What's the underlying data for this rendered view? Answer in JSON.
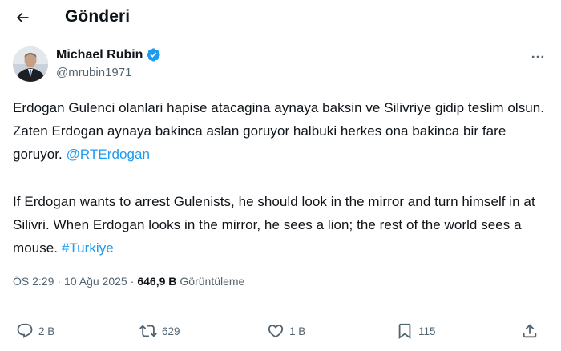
{
  "header": {
    "title": "Gönderi"
  },
  "author": {
    "name": "Michael Rubin",
    "handle": "@mrubin1971",
    "verified_color": "#1d9bf0"
  },
  "tweet": {
    "paragraph_1": "Erdogan Gulenci olanlari hapise atacagina aynaya baksin ve Silivriye gidip teslim olsun. Zaten Erdogan aynaya bakinca aslan goruyor halbuki herkes ona bakinca bir fare goruyor.",
    "mention": "@RTErdogan",
    "paragraph_2": "If Erdogan wants to arrest Gulenists, he should look in the mirror and turn himself in at Silivri. When Erdogan looks in the mirror, he sees a lion; the rest of the world sees a mouse.",
    "hashtag": "#Turkiye",
    "link_color": "#1d9bf0"
  },
  "meta": {
    "time": "ÖS 2:29",
    "separator": "·",
    "date": "10 Ağu 2025",
    "views_count": "646,9 B",
    "views_label": "Görüntüleme"
  },
  "actions": {
    "reply_count": "2 B",
    "retweet_count": "629",
    "like_count": "1 B",
    "bookmark_count": "115"
  },
  "icons": [
    "back-arrow-icon",
    "verified-badge-icon",
    "more-icon",
    "reply-icon",
    "retweet-icon",
    "like-icon",
    "bookmark-icon",
    "share-icon"
  ]
}
